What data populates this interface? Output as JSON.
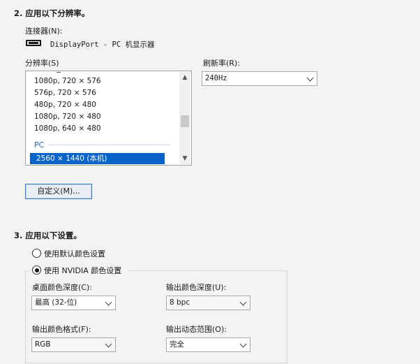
{
  "section2": {
    "title": "2. 应用以下分辨率。",
    "connector_label": "连接器(N):",
    "connector_value": "DisplayPort - PC 机显示器",
    "connector_icon": "displayport-monitor-icon",
    "resolution_label": "分辨率(S)",
    "resolution_items": [
      "1080p, 720 × 576",
      "576p, 720 × 576",
      "480p, 720 × 480",
      "1080p, 720 × 480",
      "1080p, 640 × 480"
    ],
    "resolution_group": "PC",
    "resolution_selected": "2560 × 1440 (本机)",
    "refresh_label": "刷新率(R):",
    "refresh_value": "240Hz",
    "customize_button": "自定义(M)..."
  },
  "section3": {
    "title": "3. 应用以下设置。",
    "radio_default": "使用默认颜色设置",
    "radio_nvidia": "使用 NVIDIA 颜色设置",
    "desktop_depth_label": "桌面颜色深度(C):",
    "desktop_depth_value": "最高 (32-位)",
    "output_depth_label": "输出颜色深度(U):",
    "output_depth_value": "8 bpc",
    "output_format_label": "输出颜色格式(F):",
    "output_format_value": "RGB",
    "dynamic_range_label": "输出动态范围(O):",
    "dynamic_range_value": "完全"
  }
}
